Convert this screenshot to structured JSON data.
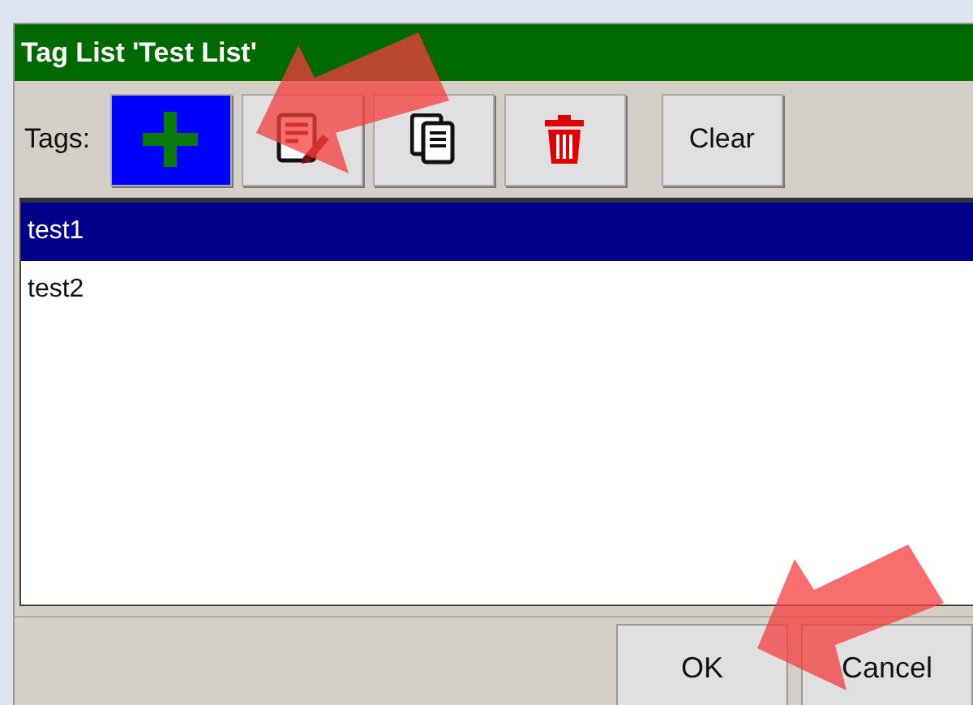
{
  "window": {
    "title": "Tag List 'Test List'"
  },
  "toolbar": {
    "label": "Tags:",
    "buttons": [
      {
        "kind": "add"
      },
      {
        "kind": "edit"
      },
      {
        "kind": "copy"
      },
      {
        "kind": "delete"
      },
      {
        "kind": "text",
        "label": "Clear"
      }
    ]
  },
  "list": {
    "items": [
      {
        "label": "test1",
        "selected": true
      },
      {
        "label": "test2",
        "selected": false
      }
    ]
  },
  "footer": {
    "buttons": [
      {
        "label": "OK"
      },
      {
        "label": "Cancel"
      }
    ]
  },
  "annotations": [
    {
      "kind": "arrow"
    },
    {
      "kind": "arrow"
    }
  ]
}
